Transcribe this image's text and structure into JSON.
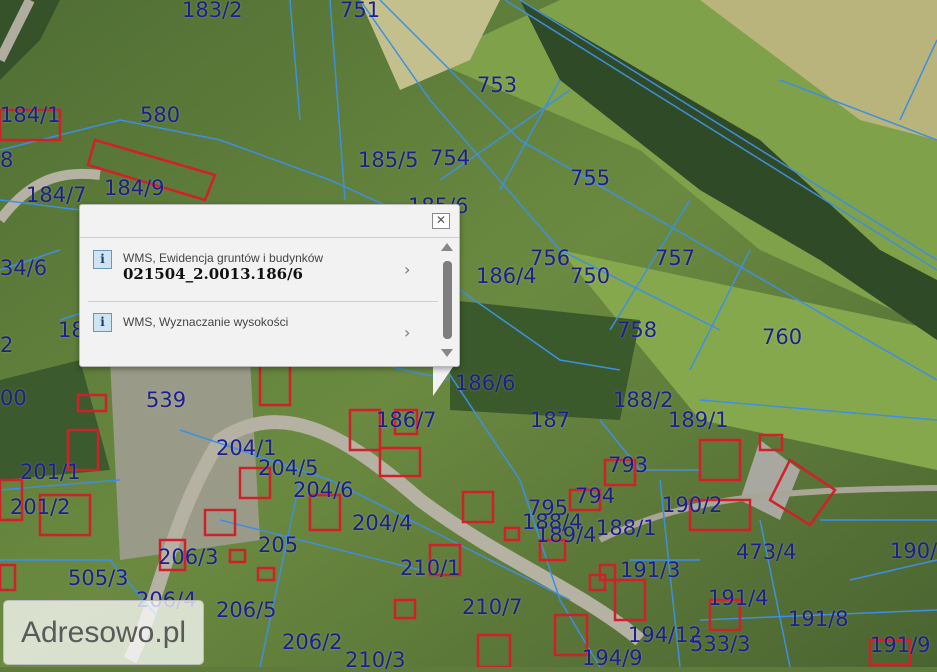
{
  "map": {
    "parcel_line_color": "#3f8fe0",
    "building_color": "#d2202a",
    "label_color": "#1d1f8f",
    "plot_labels": [
      "183/2",
      "751",
      "753",
      "580",
      "184/1",
      "8",
      "754",
      "185/5",
      "755",
      "184/7",
      "184/9",
      "185/6",
      "756",
      "757",
      "34/6",
      "186/4",
      "750",
      "18",
      "758",
      "760",
      "2",
      "186/6",
      "00",
      "539",
      "188/2",
      "189/1",
      "187",
      "186/7",
      "204/1",
      "204/5",
      "201/1",
      "793",
      "204/6",
      "794",
      "795",
      "190/2",
      "201/2",
      "204/4",
      "188/4",
      "188/1",
      "189/4",
      "205",
      "206/3",
      "473/4",
      "190/",
      "210/1",
      "191/3",
      "505/3",
      "206/4",
      "191/4",
      "206/5",
      "210/7",
      "191/8",
      "206/2",
      "194/12",
      "533/3",
      "210/3",
      "194/9",
      "191/9"
    ]
  },
  "popup": {
    "close_label": "✕",
    "results": [
      {
        "layer_title": "WMS, Ewidencja gruntów i budynków",
        "value": "021504_2.0013.186/6",
        "icon": "i",
        "chevron": "›"
      },
      {
        "layer_title": "WMS, Wyznaczanie wysokości",
        "value": "",
        "icon": "i",
        "chevron": "›"
      }
    ]
  },
  "brand": {
    "label": "Adresowo.pl"
  }
}
